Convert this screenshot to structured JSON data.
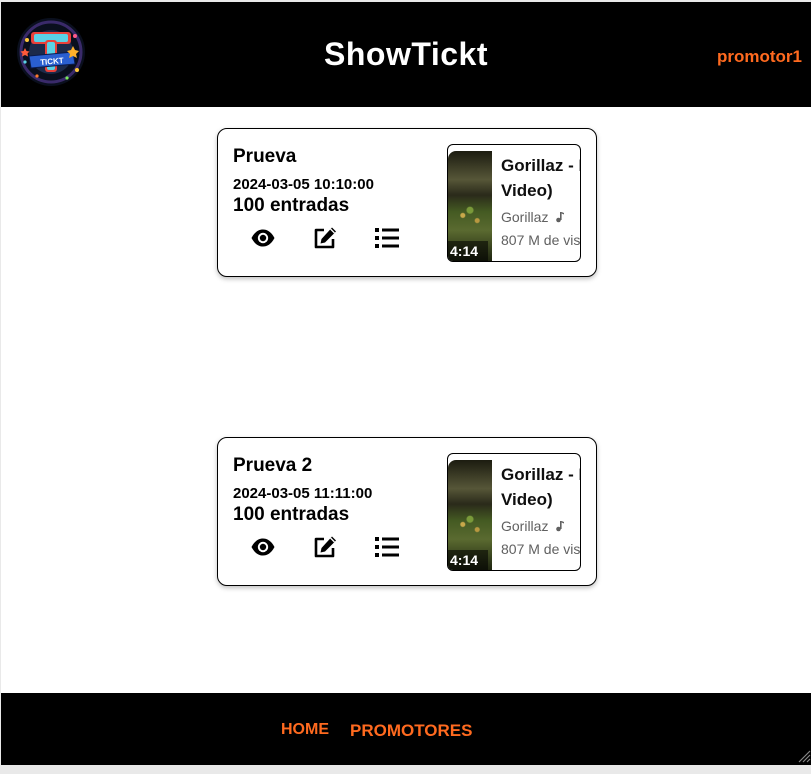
{
  "header": {
    "app_title": "ShowTickt",
    "username": "promotor1",
    "logo_text": "TICKT",
    "logo_letter": "T"
  },
  "events": [
    {
      "name": "Prueva",
      "datetime": "2024-03-05 10:10:00",
      "tickets": "100 entradas",
      "video": {
        "title_line1": "Gorillaz - F",
        "title_line2": "Video)",
        "channel": "Gorillaz",
        "views": "807 M de vis",
        "duration": "4:14"
      }
    },
    {
      "name": "Prueva 2",
      "datetime": "2024-03-05 11:11:00",
      "tickets": "100 entradas",
      "video": {
        "title_line1": "Gorillaz - F",
        "title_line2": "Video)",
        "channel": "Gorillaz",
        "views": "807 M de vis",
        "duration": "4:14"
      }
    }
  ],
  "footer": {
    "nav_home": "HOME",
    "nav_promotores": "PROMOTORES"
  },
  "icons": {
    "view": "eye-icon",
    "edit": "edit-icon",
    "list": "list-icon",
    "music": "music-note-icon"
  },
  "colors": {
    "header_bg": "#000000",
    "accent": "#ff6a1f",
    "card_border": "#000000",
    "page_bg": "#ffffff"
  }
}
